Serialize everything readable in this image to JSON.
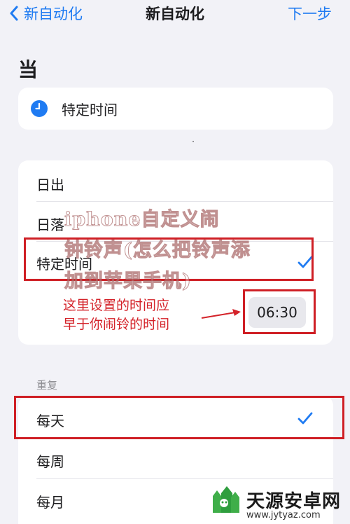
{
  "nav": {
    "back_label": "新自动化",
    "title": "新自动化",
    "next_label": "下一步"
  },
  "section_title": "当",
  "trigger": {
    "label": "特定时间"
  },
  "options": [
    {
      "label": "日出",
      "checked": false
    },
    {
      "label": "日落",
      "checked": false
    },
    {
      "label": "特定时间",
      "checked": true
    }
  ],
  "time_value": "06:30",
  "annotation": {
    "line1": "这里设置的时间应",
    "line2": "早于你闹铃的时间"
  },
  "repeat": {
    "header": "重复",
    "items": [
      {
        "label": "每天",
        "checked": true
      },
      {
        "label": "每周",
        "checked": false
      },
      {
        "label": "每月",
        "checked": false
      }
    ]
  },
  "watermark": {
    "line1": "iphone自定义闹",
    "line2": "钟铃声(怎么把铃声添",
    "line3": "加到苹果手机)"
  },
  "logo": {
    "name": "天源安卓网",
    "url": "www.jytyaz.com"
  },
  "colors": {
    "accent": "#1f7bf2",
    "annotation_red": "#d4232a",
    "background": "#f2f2f7"
  }
}
